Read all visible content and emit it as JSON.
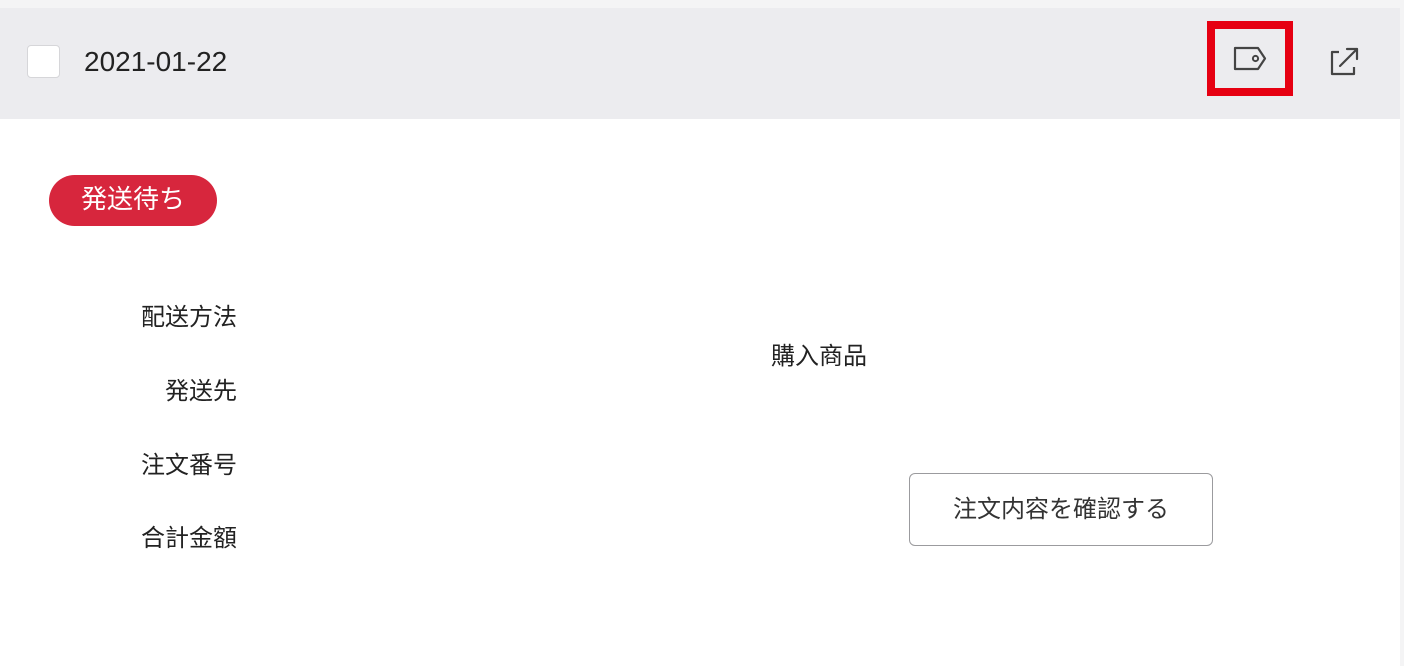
{
  "order": {
    "date": "2021-01-22",
    "status": "発送待ち",
    "labels": {
      "shipping_method": "配送方法",
      "shipping_destination": "発送先",
      "order_number": "注文番号",
      "total_amount": "合計金額",
      "purchased_items": "購入商品"
    },
    "actions": {
      "view_order": "注文内容を確認する"
    },
    "header_icons": {
      "tag": "tag-icon",
      "external": "external-link-icon"
    }
  },
  "colors": {
    "status_badge": "#d7263d",
    "highlight_border": "#e60012",
    "header_background": "#ececef"
  }
}
